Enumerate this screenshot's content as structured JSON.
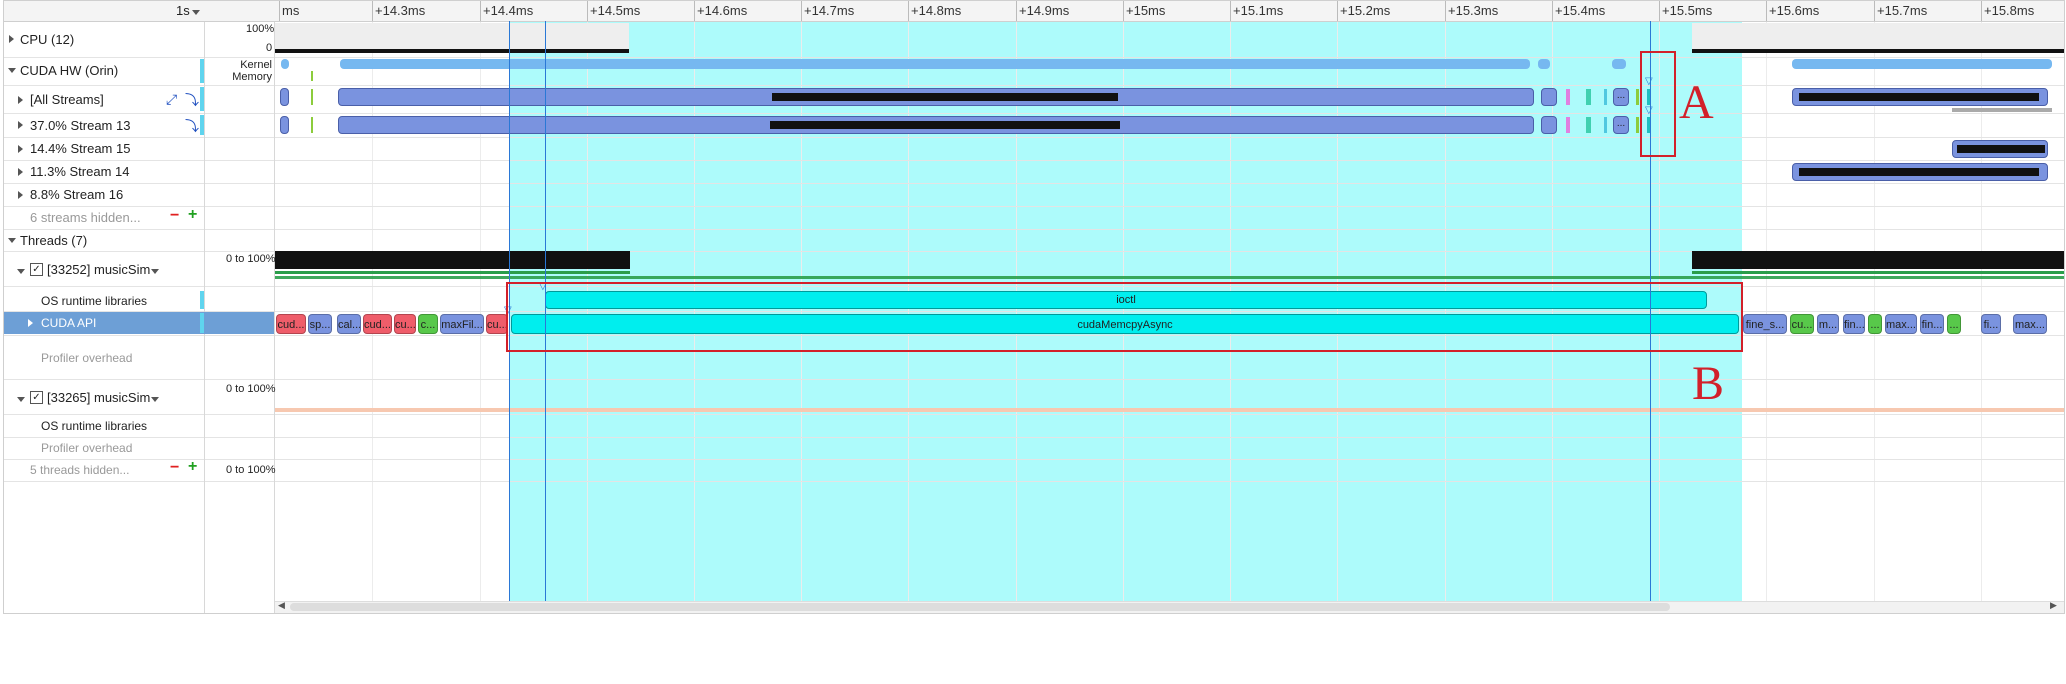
{
  "ruler": {
    "scale_label": "1s",
    "ticks": [
      "ms",
      "+14.3ms",
      "+14.4ms",
      "+14.5ms",
      "+14.6ms",
      "+14.7ms",
      "+14.8ms",
      "+14.9ms",
      "+15ms",
      "+15.1ms",
      "+15.2ms",
      "+15.3ms",
      "+15.4ms",
      "+15.5ms",
      "+15.6ms",
      "+15.7ms",
      "+15.8ms"
    ]
  },
  "rows": {
    "cpu": "CPU (12)",
    "cpu_scale_top": "100%",
    "cpu_scale_bottom": "0",
    "cuda_hw": "CUDA HW (Orin)",
    "kernel_memory": "Kernel\nMemory",
    "all_streams": "[All Streams]",
    "stream13": "37.0% Stream 13",
    "stream15": "14.4% Stream 15",
    "stream14": "11.3% Stream 14",
    "stream16": "8.8% Stream 16",
    "streams_hidden": "6 streams hidden...",
    "threads": "Threads (7)",
    "thread1": "[33252] musicSim",
    "thread1_scale": "0 to 100%",
    "os_runtime": "OS runtime libraries",
    "cuda_api": "CUDA API",
    "profiler_overhead": "Profiler overhead",
    "thread2": "[33265] musicSim",
    "thread2_scale": "0 to 100%",
    "os_runtime2": "OS runtime libraries",
    "profiler_overhead2": "Profiler overhead",
    "threads_hidden": "5 threads hidden...",
    "threads_hidden_scale": "0 to 100%"
  },
  "events": {
    "ioctl": "ioctl",
    "memcpy": "cudaMemcpyAsync",
    "api_chips_left": [
      "cud...",
      "sp...",
      "cal...",
      "cud...",
      "cu...",
      "c...",
      "maxFil...",
      "cu..."
    ],
    "api_chips_right": [
      "fine_s...",
      "cu...",
      "m...",
      "fin...",
      "...",
      "max...",
      "fin...",
      "...",
      "fi...",
      "max..."
    ],
    "stream_dots": "..."
  },
  "annotations": {
    "a": "A",
    "b": "B"
  },
  "colors": {
    "selection": "#adfbfb",
    "kernel_blue": "#7a93df",
    "memcpy_cyan": "#00eeee",
    "annotation_red": "#d2202a"
  }
}
